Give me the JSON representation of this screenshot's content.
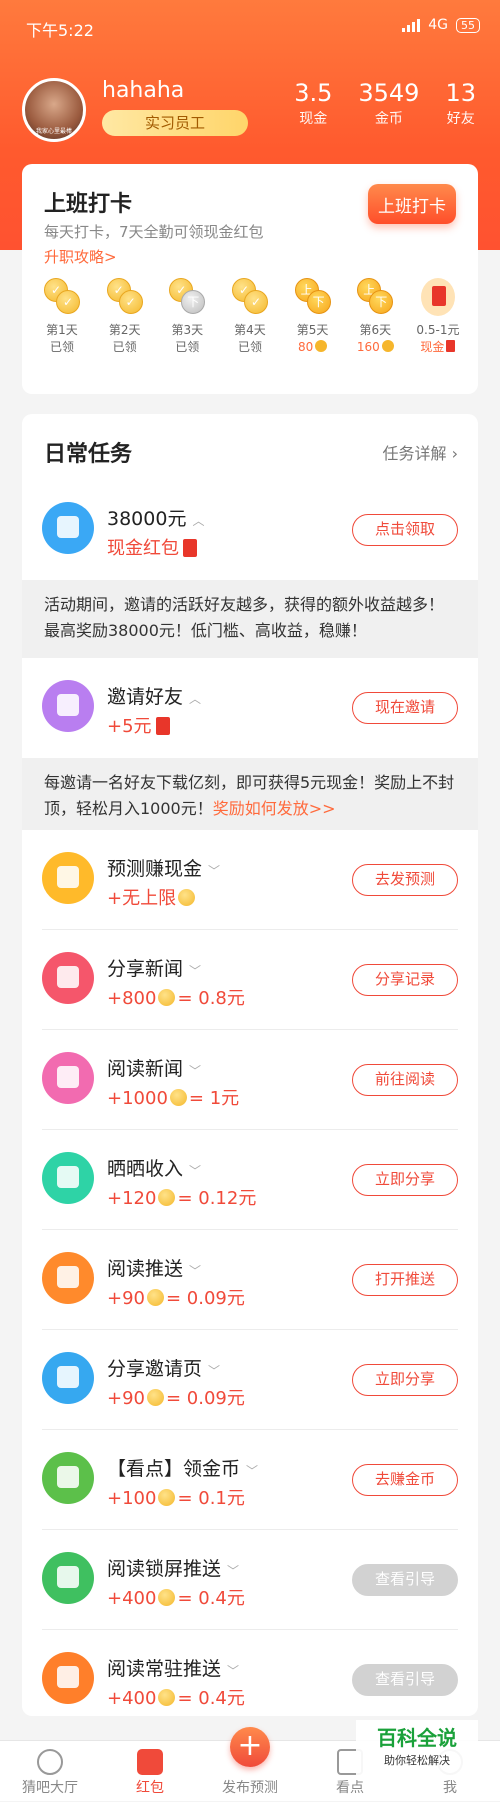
{
  "status_bar": {
    "time": "下午5:22",
    "network": "4G",
    "battery": "55"
  },
  "profile": {
    "avatar_caption": "我家心里最棒",
    "username": "hahaha",
    "badge": "实习员工",
    "stats": [
      {
        "value": "3.5",
        "label": "现金"
      },
      {
        "value": "3549",
        "label": "金币"
      },
      {
        "value": "13",
        "label": "好友"
      }
    ]
  },
  "checkin": {
    "title": "上班打卡",
    "description": "每天打卡，7天全勤可领现金红包",
    "promo_link": "升职攻略>",
    "button": "上班打卡",
    "days": [
      {
        "label": "第1天",
        "value": "已领",
        "state": "claimed"
      },
      {
        "label": "第2天",
        "value": "已领",
        "state": "claimed"
      },
      {
        "label": "第3天",
        "value": "已领",
        "state": "claimed-silver",
        "coin_char": "下"
      },
      {
        "label": "第4天",
        "value": "已领",
        "state": "claimed"
      },
      {
        "label": "第5天",
        "value": "80",
        "state": "future",
        "coin_char": "上",
        "coin_char2": "下"
      },
      {
        "label": "第6天",
        "value": "160",
        "state": "future",
        "coin_char": "上",
        "coin_char2": "下"
      },
      {
        "label": "0.5-1元",
        "value": "现金",
        "state": "redpack"
      }
    ]
  },
  "tasks": {
    "title": "日常任务",
    "detail_link": "任务详解",
    "items": [
      {
        "name": "38000元",
        "sub": "现金红包",
        "button": "点击领取",
        "color": "#3aa8f5",
        "expanded": true
      },
      {
        "name": "邀请好友",
        "sub": "+5元",
        "button": "现在邀请",
        "color": "#b97ef0",
        "expanded": true
      },
      {
        "name": "预测赚现金",
        "sub": "+无上限",
        "button": "去发预测",
        "color": "#ffba2a"
      },
      {
        "name": "分享新闻",
        "sub_amount": "+800",
        "sub_value": "= 0.8元",
        "button": "分享记录",
        "color": "#f5566b"
      },
      {
        "name": "阅读新闻",
        "sub_amount": "+1000",
        "sub_value": "= 1元",
        "button": "前往阅读",
        "color": "#f26bb0"
      },
      {
        "name": "晒晒收入",
        "sub_amount": "+120",
        "sub_value": "= 0.12元",
        "button": "立即分享",
        "color": "#2ed3a6"
      },
      {
        "name": "阅读推送",
        "sub_amount": "+90",
        "sub_value": "= 0.09元",
        "button": "打开推送",
        "color": "#ff8a2c"
      },
      {
        "name": "分享邀请页",
        "sub_amount": "+90",
        "sub_value": "= 0.09元",
        "button": "立即分享",
        "color": "#36a8f0"
      },
      {
        "name": "【看点】领金币",
        "sub_amount": "+100",
        "sub_value": "= 0.1元",
        "button": "去赚金币",
        "color": "#5cc04a"
      },
      {
        "name": "阅读锁屏推送",
        "sub_amount": "+400",
        "sub_value": "= 0.4元",
        "button": "查看引导",
        "color": "#3fc060",
        "disabled": true
      },
      {
        "name": "阅读常驻推送",
        "sub_amount": "+400",
        "sub_value": "= 0.4元",
        "button": "查看引导",
        "color": "#ff7f2a",
        "disabled": true
      }
    ],
    "notices": [
      {
        "text": "活动期间，邀请的活跃好友越多，获得的额外收益越多！最高奖励38000元！低门槛、高收益，稳赚！"
      },
      {
        "text": "每邀请一名好友下载亿刻，即可获得5元现金！奖励上不封顶，轻松月入1000元！",
        "link": "奖励如何发放>>"
      }
    ]
  },
  "watermark": {
    "title": "百科全说",
    "subtitle": "助你轻松解决"
  },
  "tabbar": [
    {
      "label": "猜吧大厅"
    },
    {
      "label": "红包",
      "active": true
    },
    {
      "label": "发布预测",
      "center": true
    },
    {
      "label": "看点"
    },
    {
      "label": "我"
    }
  ]
}
